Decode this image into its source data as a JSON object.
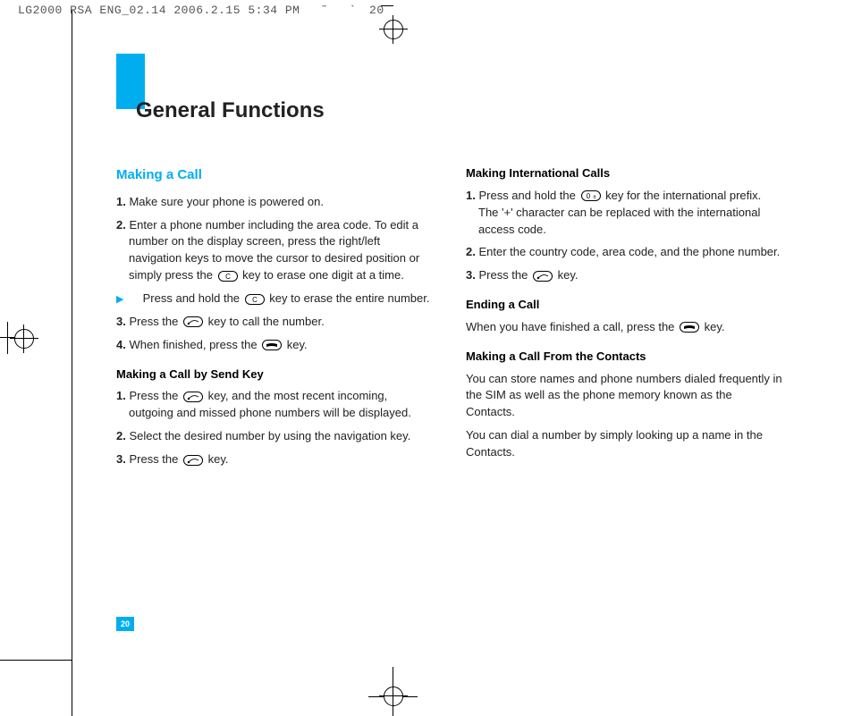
{
  "meta": {
    "header": "LG2000 RSA ENG_02.14  2006.2.15 5:34 PM",
    "header_page": "20"
  },
  "title": "General Functions",
  "page_number": "20",
  "left": {
    "h2": "Making a Call",
    "steps1": [
      {
        "n": "1.",
        "t": "Make sure your phone is powered on."
      },
      {
        "n": "2.",
        "t_before": "Enter a phone number including the area code. To edit a number on the display screen, press the right/left navigation keys to move the cursor to desired position or simply press the ",
        "t_after": " key to erase one digit at a time.",
        "key": "c"
      }
    ],
    "tip": {
      "before": "Press and hold the ",
      "after": " key to erase the entire number.",
      "key": "c"
    },
    "steps2": [
      {
        "n": "3.",
        "t_before": "Press the ",
        "t_after": " key to call the number.",
        "key": "send"
      },
      {
        "n": "4.",
        "t_before": "When finished, press the ",
        "t_after": " key.",
        "key": "end"
      }
    ],
    "h3a": "Making a Call by Send Key",
    "steps3": [
      {
        "n": "1.",
        "t_before": "Press the ",
        "t_after": " key, and the most recent incoming, outgoing and missed phone numbers will be displayed.",
        "key": "send"
      },
      {
        "n": "2.",
        "t": "Select the desired number by using the navigation key."
      },
      {
        "n": "3.",
        "t_before": "Press the ",
        "t_after": " key.",
        "key": "send"
      }
    ]
  },
  "right": {
    "h3a": "Making International Calls",
    "steps1": [
      {
        "n": "1.",
        "t_before": "Press and hold the ",
        "t_after": " key for the international prefix. The '+' character can be replaced with the international access code.",
        "key": "zero"
      },
      {
        "n": "2.",
        "t": "Enter the country code, area code, and the phone number."
      },
      {
        "n": "3.",
        "t_before": "Press the ",
        "t_after": " key.",
        "key": "send"
      }
    ],
    "h3b": "Ending a Call",
    "p1": {
      "before": "When you have finished a call, press the ",
      "after": " key.",
      "key": "end"
    },
    "h3c": "Making a Call From the Contacts",
    "p2": "You can store names and phone numbers dialed frequently in the SIM as well as the phone memory known as the Contacts.",
    "p3": "You can dial a number by simply looking up a name in the Contacts."
  }
}
